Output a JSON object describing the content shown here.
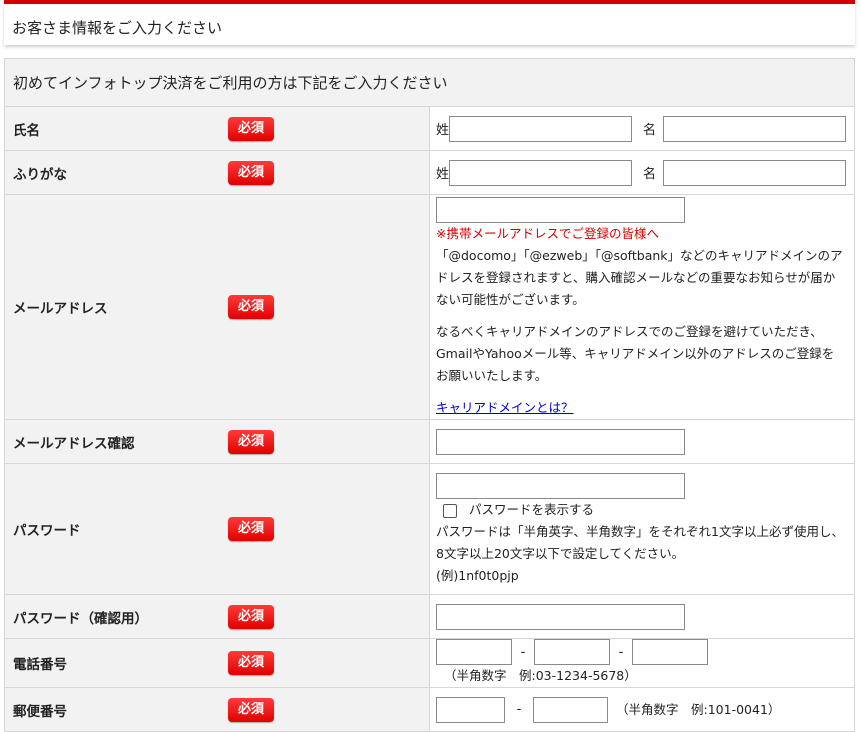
{
  "header": {
    "title": "お客さま情報をご入力ください"
  },
  "form": {
    "caption": "初めてインフォトップ決済をご利用の方は下記をご入力ください",
    "required_badge": "必須",
    "name": {
      "label": "氏名",
      "last_label": "姓",
      "first_label": "名",
      "last_value": "",
      "first_value": ""
    },
    "furigana": {
      "label": "ふりがな",
      "last_label": "姓",
      "first_label": "名",
      "last_value": "",
      "first_value": ""
    },
    "email": {
      "label": "メールアドレス",
      "value": "",
      "warning": "※携帯メールアドレスでご登録の皆様へ",
      "note1": "「@docomo」「@ezweb」「@softbank」などのキャリアドメインのアドレスを登録されますと、購入確認メールなどの重要なお知らせが届かない可能性がございます。",
      "note2": "なるべくキャリアドメインのアドレスでのご登録を避けていただき、GmailやYahooメール等、キャリアドメイン以外のアドレスのご登録をお願いいたします。",
      "link": "キャリアドメインとは？"
    },
    "email_confirm": {
      "label": "メールアドレス確認",
      "value": ""
    },
    "password": {
      "label": "パスワード",
      "value": "",
      "show_label": "パスワードを表示する",
      "rule1": "パスワードは「半角英字、半角数字」をそれぞれ1文字以上必ず使用し、",
      "rule2": "8文字以上20文字以下で設定してください。",
      "example": "(例)1nf0t0pjp"
    },
    "password_confirm": {
      "label": "パスワード（確認用）",
      "value": ""
    },
    "phone": {
      "label": "電話番号",
      "separator": "-",
      "hint": "（半角数字　例:03-1234-5678）",
      "part1": "",
      "part2": "",
      "part3": ""
    },
    "postal": {
      "label": "郵便番号",
      "separator": "-",
      "hint": "（半角数字　例:101-0041）",
      "part1": "",
      "part2": ""
    }
  }
}
